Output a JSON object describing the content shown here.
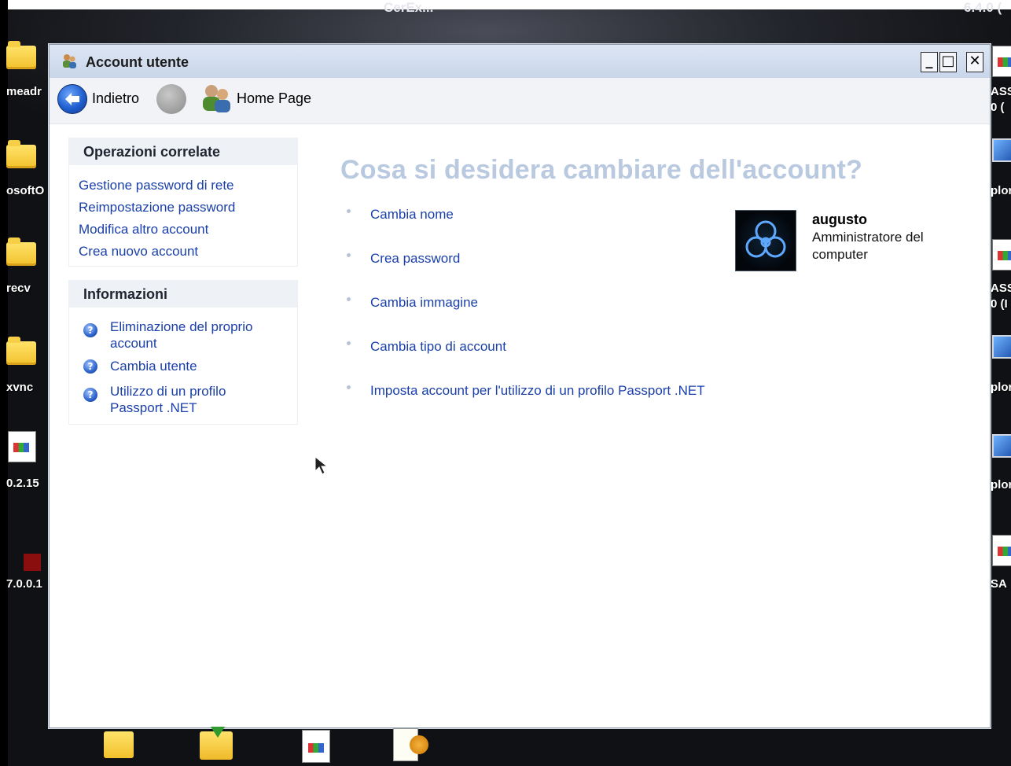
{
  "desktop": {
    "top_texts": [
      "CerEx...",
      "6.4.0 ("
    ],
    "left_labels": [
      "meadr",
      "osoftO",
      "recv",
      "xvnc",
      "0.2.15",
      "7.0.0.1"
    ],
    "right_labels": [
      "ASS",
      "0 (",
      "plor",
      "ASS",
      "0 (I",
      "plor",
      "plor",
      "SA"
    ]
  },
  "window": {
    "title": "Account utente",
    "controls": {
      "minimize": "_",
      "maximize": "□",
      "close": "✕"
    },
    "nav": {
      "back_label": "Indietro",
      "home_label": "Home Page"
    }
  },
  "sidebar": {
    "related": {
      "heading": "Operazioni correlate",
      "links": [
        "Gestione password di rete",
        "Reimpostazione password",
        "Modifica altro account",
        "Crea nuovo account"
      ]
    },
    "info": {
      "heading": "Informazioni",
      "links": [
        "Eliminazione del proprio account",
        "Cambia utente",
        "Utilizzo di un profilo Passport .NET"
      ]
    }
  },
  "main": {
    "title": "Cosa si desidera cambiare dell'account?",
    "tasks": [
      "Cambia nome",
      "Crea password",
      "Cambia immagine",
      "Cambia tipo di account",
      "Imposta account per l'utilizzo di un profilo Passport .NET"
    ]
  },
  "user": {
    "name": "augusto",
    "role": "Amministratore del computer"
  },
  "icons": {
    "help": "?",
    "back": "back-arrow-icon",
    "forward": "forward-icon",
    "home": "users-icon"
  }
}
